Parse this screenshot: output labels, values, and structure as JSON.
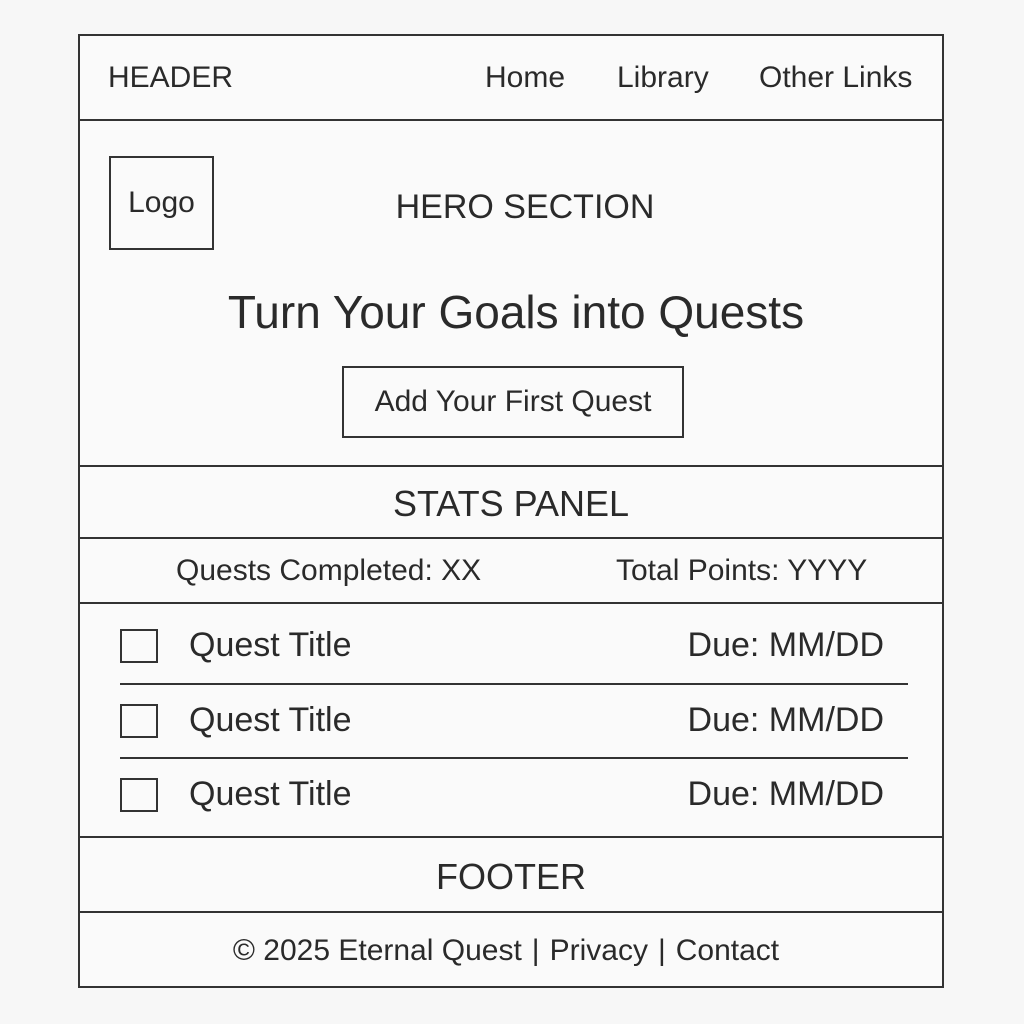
{
  "header": {
    "label": "HEADER",
    "nav": [
      "Home",
      "Library",
      "Other Links"
    ]
  },
  "hero": {
    "logo": "Logo",
    "label": "HERO SECTION",
    "title": "Turn Your Goals into Quests",
    "cta": "Add Your First Quest"
  },
  "stats": {
    "label": "STATS PANEL",
    "completed": "Quests Completed: XX",
    "points": "Total Points: YYYY"
  },
  "quests": [
    {
      "title": "Quest Title",
      "due": "Due: MM/DD"
    },
    {
      "title": "Quest Title",
      "due": "Due: MM/DD"
    },
    {
      "title": "Quest Title",
      "due": "Due: MM/DD"
    }
  ],
  "footer": {
    "label": "FOOTER",
    "copyright": "© 2025 Eternal Quest",
    "separator": "|",
    "links": [
      "Privacy",
      "Contact"
    ]
  }
}
